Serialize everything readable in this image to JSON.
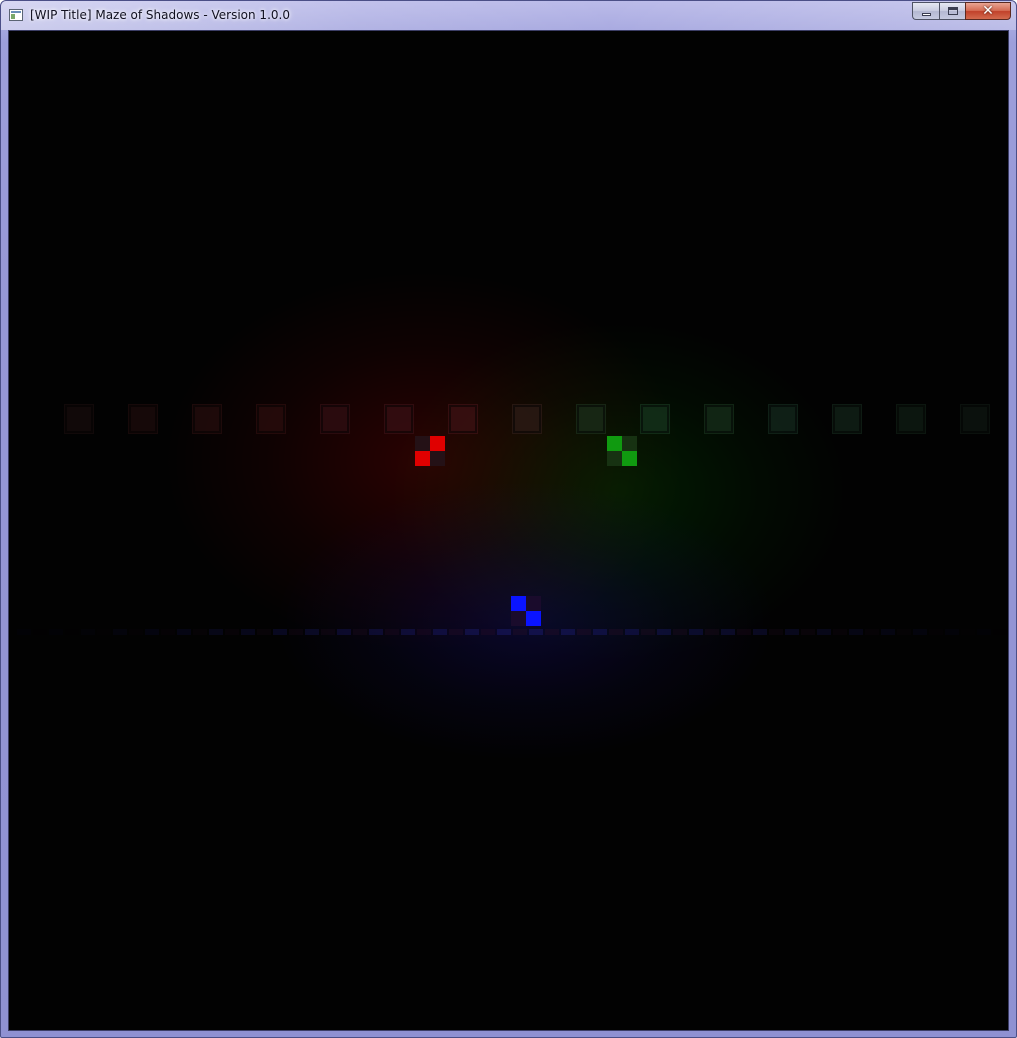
{
  "window": {
    "title": "[WIP Title] Maze of Shadows - Version 1.0.0",
    "icon": "application-window-icon",
    "controls": {
      "minimize_icon": "minimize-icon",
      "maximize_icon": "maximize-icon",
      "close_icon": "close-icon",
      "close_glyph": "✕"
    }
  },
  "game": {
    "background_color": "#020202",
    "lights": [
      {
        "name": "red",
        "color": "#ff0000"
      },
      {
        "name": "green",
        "color": "#00c000"
      },
      {
        "name": "blue",
        "color": "#0000ff"
      }
    ],
    "players": [
      {
        "name": "red-player",
        "color": "#e00000",
        "dark": "#241116"
      },
      {
        "name": "green-player",
        "color": "#109a10",
        "dark": "#173212"
      },
      {
        "name": "blue-player",
        "color": "#0a14ff",
        "dark": "#1a0b2c"
      }
    ],
    "maze_wall_color": "#3a3030",
    "floor_strip_color": "#0f0f3a"
  }
}
